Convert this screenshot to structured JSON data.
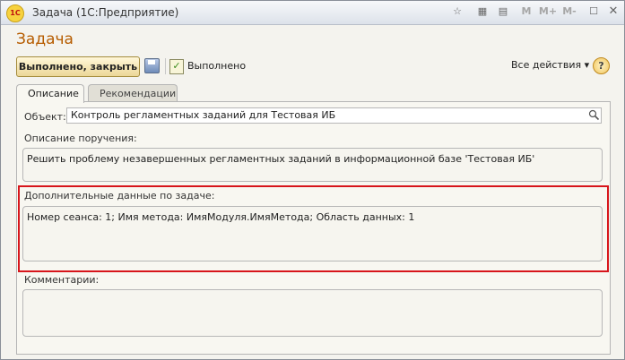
{
  "window": {
    "title": "Задача  (1С:Предприятие)",
    "title_buttons": [
      "M",
      "M+",
      "M-"
    ]
  },
  "header": {
    "title": "Задача"
  },
  "toolbar": {
    "done_close": "Выполнено, закрыть",
    "done": "Выполнено",
    "all_actions": "Все действия ▾",
    "help": "?"
  },
  "tabs": [
    {
      "label": "Описание",
      "active": true
    },
    {
      "label": "Рекомендации",
      "active": false
    }
  ],
  "form": {
    "object_label": "Объект:",
    "object_value": "Контроль регламентных заданий для Тестовая ИБ",
    "description_label": "Описание поручения:",
    "description_value": "Решить проблему незавершенных регламентных заданий в информационной базе 'Тестовая ИБ'",
    "additional_label": "Дополнительные данные по задаче:",
    "additional_value": "Номер сеанса: 1; Имя метода: ИмяМодуля.ИмяМетода; Область данных: 1",
    "comments_label": "Комментарии:",
    "comments_value": ""
  },
  "colors": {
    "title_accent": "#b65c00",
    "highlight": "#d7151b"
  }
}
